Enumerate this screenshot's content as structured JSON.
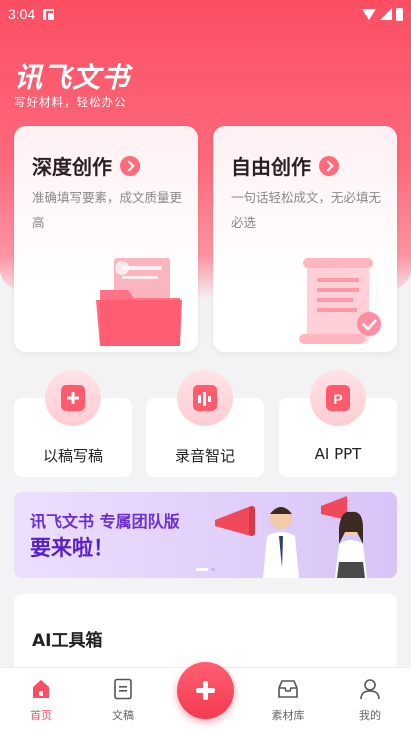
{
  "status_bar": {
    "time": "3:04"
  },
  "header": {
    "app_title": "讯飞文书",
    "tagline": "写好材料，轻松办公"
  },
  "create_cards": [
    {
      "title": "深度创作",
      "desc": "准确填写要素，成文质量更高"
    },
    {
      "title": "自由创作",
      "desc": "一句话轻松成文，无必填无必选"
    }
  ],
  "tools": [
    {
      "label": "以稿写稿",
      "icon": "doc-plus-icon"
    },
    {
      "label": "录音智记",
      "icon": "audio-wave-icon"
    },
    {
      "label": "AI PPT",
      "icon": "ppt-icon"
    }
  ],
  "banner": {
    "line1": "讯飞文书 专属团队版",
    "line2": "要来啦！"
  },
  "ai_toolbox": {
    "title": "AI工具箱"
  },
  "bottom_nav": [
    {
      "label": "首页",
      "icon": "home-icon",
      "active": true
    },
    {
      "label": "文稿",
      "icon": "document-icon",
      "active": false
    },
    {
      "label": "素材库",
      "icon": "inbox-icon",
      "active": false
    },
    {
      "label": "我的",
      "icon": "user-icon",
      "active": false
    }
  ],
  "colors": {
    "primary": "#fb4e63",
    "banner_text": "#5a1fc9"
  }
}
